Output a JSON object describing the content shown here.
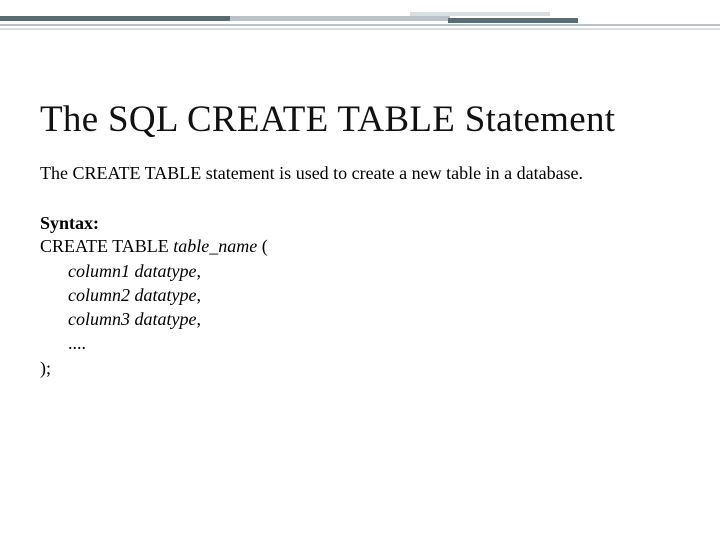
{
  "title": "The SQL CREATE TABLE Statement",
  "description": "The CREATE TABLE statement is used to create a new table in a database.",
  "syntax_label": "Syntax:",
  "code": {
    "l1_a": "CREATE TABLE ",
    "l1_b": "table_name",
    "l1_c": " (",
    "l2_a": "column1 datatype",
    "l2_b": ",",
    "l3_a": "column2 datatype",
    "l3_b": ",",
    "l4_a": "column3 datatype",
    "l4_b": ",",
    "l5": "....",
    "l6": ");"
  }
}
